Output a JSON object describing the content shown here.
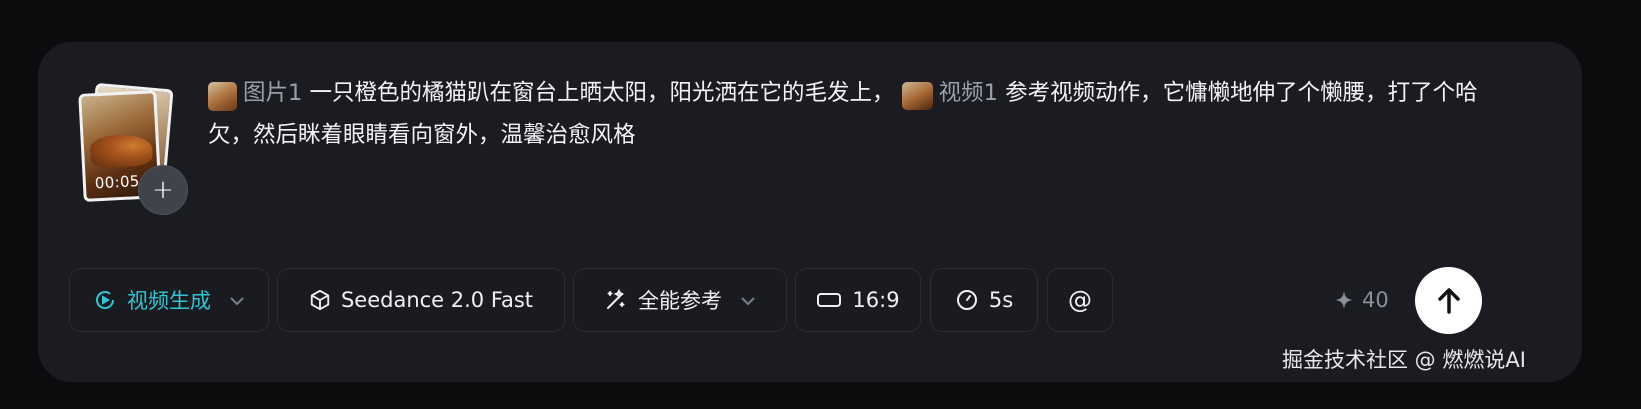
{
  "media": {
    "duration": "00:05",
    "add_label": "+"
  },
  "prompt": {
    "ref_image_label": "图片1",
    "text_1": " 一只橙色的橘猫趴在窗台上晒太阳，阳光洒在它的毛发上，",
    "ref_video_label": "视频1",
    "text_2": " 参考视频动作，它慵懒地伸了个懒腰，打了个哈欠，然后眯着眼睛看向窗外，温馨治愈风格"
  },
  "toolbar": {
    "mode_label": "视频生成",
    "model_label": "Seedance 2.0 Fast",
    "reference_label": "全能参考",
    "ratio_label": "16:9",
    "duration_label": "5s",
    "mention_label": "@",
    "credits": "40",
    "accent_color": "#2fc5d4"
  },
  "watermark": "掘金技术社区 @ 燃燃说AI"
}
